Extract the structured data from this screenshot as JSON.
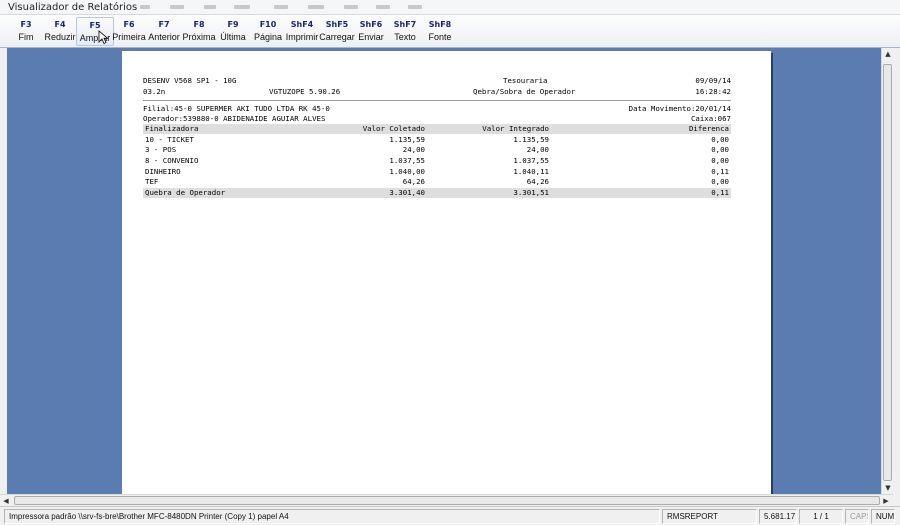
{
  "window": {
    "title": "Visualizador de Relatórios"
  },
  "toolbar": {
    "buttons": [
      {
        "key": "F3",
        "label": "Fim"
      },
      {
        "key": "F4",
        "label": "Reduzir"
      },
      {
        "key": "F5",
        "label": "Ampliar"
      },
      {
        "key": "F6",
        "label": "Primeira"
      },
      {
        "key": "F7",
        "label": "Anterior"
      },
      {
        "key": "F8",
        "label": "Próxima"
      },
      {
        "key": "F9",
        "label": "Última"
      },
      {
        "key": "F10",
        "label": "Página"
      },
      {
        "key": "ShF4",
        "label": "Imprimir"
      },
      {
        "key": "ShF5",
        "label": "Carregar"
      },
      {
        "key": "ShF6",
        "label": "Enviar"
      },
      {
        "key": "ShF7",
        "label": "Texto"
      },
      {
        "key": "ShF8",
        "label": "Fonte"
      }
    ]
  },
  "report": {
    "header": {
      "system": "DESENV V568 SP1 - 10G",
      "date": "09/09/14",
      "version": "03.2n",
      "program": "VGTUZOPE 5.90.26",
      "module": "Tesouraria",
      "title": "Qebra/Sobra de Operador",
      "time": "16:28:42"
    },
    "info": {
      "filial": "Filial:45-0 SUPERMER AKI TUDO LTDA RK 45-0",
      "data_movimento": "Data Movimento:20/01/14",
      "operador": "Operador:539880-0 ABIDENAIDE AGUIAR ALVES",
      "caixa": "Caixa:067"
    },
    "columns": [
      "Finalizadora",
      "Valor Coletado",
      "Valor Integrado",
      "Diferenca"
    ],
    "rows": [
      [
        "10 - TICKET",
        "1.135,59",
        "1.135,59",
        "0,00"
      ],
      [
        "3 - POS",
        "24,00",
        "24,00",
        "0,00"
      ],
      [
        "8 - CONVENIO",
        "1.037,55",
        "1.037,55",
        "0,00"
      ],
      [
        "DINHEIRO",
        "1.040,00",
        "1.040,11",
        "0,11"
      ],
      [
        "TEF",
        "64,26",
        "64,26",
        "0,00"
      ]
    ],
    "total": [
      "Quebra de Operador",
      "3.301,40",
      "3.301,51",
      "0,11"
    ]
  },
  "status": {
    "printer": "Impressora padrão \\\\srv-fs-bre\\Brother MFC-8480DN Printer (Copy 1) papel A4",
    "app": "RMSREPORT",
    "build": "5.681.17",
    "pages": "1 / 1",
    "caps": "CAPS",
    "num": "NUM"
  }
}
